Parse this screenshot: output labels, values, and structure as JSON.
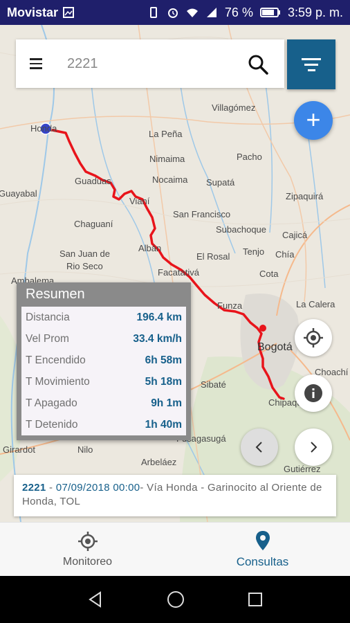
{
  "status_bar": {
    "carrier": "Movistar",
    "battery": "76 %",
    "time": "3:59 p. m."
  },
  "search": {
    "value": "2221"
  },
  "map": {
    "places": [
      {
        "name": "Villagómez"
      },
      {
        "name": "La Peña"
      },
      {
        "name": "Nimaima"
      },
      {
        "name": "Pacho"
      },
      {
        "name": "Guaduas"
      },
      {
        "name": "Nocaima"
      },
      {
        "name": "Supatá"
      },
      {
        "name": "Zipaquirá"
      },
      {
        "name": "Chaguaní"
      },
      {
        "name": "Vianí"
      },
      {
        "name": "San Francisco"
      },
      {
        "name": "Subachoque"
      },
      {
        "name": "Cajicá"
      },
      {
        "name": "San Juan de"
      },
      {
        "name": "Rio Seco"
      },
      {
        "name": "Albán"
      },
      {
        "name": "El Rosal"
      },
      {
        "name": "Tenjo"
      },
      {
        "name": "Chía"
      },
      {
        "name": "Facatativá"
      },
      {
        "name": "Cota"
      },
      {
        "name": "Funza"
      },
      {
        "name": "La Calera"
      },
      {
        "name": "Bogotá"
      },
      {
        "name": "Sibaté"
      },
      {
        "name": "Chipaque"
      },
      {
        "name": "Choachí"
      },
      {
        "name": "Fusagasugá"
      },
      {
        "name": "Arbeláez"
      },
      {
        "name": "Nilo"
      },
      {
        "name": "Girardot"
      },
      {
        "name": "Gutiérrez"
      },
      {
        "name": "Ambalema"
      },
      {
        "name": "Honda"
      },
      {
        "name": "Guayabal"
      }
    ]
  },
  "summary": {
    "title": "Resumen",
    "rows": [
      {
        "label": "Distancia",
        "value": "196.4 km"
      },
      {
        "label": "Vel Prom",
        "value": "33.4 km/h"
      },
      {
        "label": "T Encendido",
        "value": "6h 58m"
      },
      {
        "label": "T Movimiento",
        "value": "5h 18m"
      },
      {
        "label": "T Apagado",
        "value": "9h 1m"
      },
      {
        "label": "T Detenido",
        "value": "1h 40m"
      }
    ]
  },
  "route_info": {
    "vehicle": "2221",
    "date": "07/09/2018",
    "time": "00:00",
    "sep": "-",
    "description": "Vía Honda - Garinocito al Oriente de Honda, TOL"
  },
  "bottom_nav": {
    "monitoreo": "Monitoreo",
    "consultas": "Consultas"
  },
  "colors": {
    "accent": "#17608b",
    "fab": "#3c86e8",
    "route": "#e8141b"
  }
}
